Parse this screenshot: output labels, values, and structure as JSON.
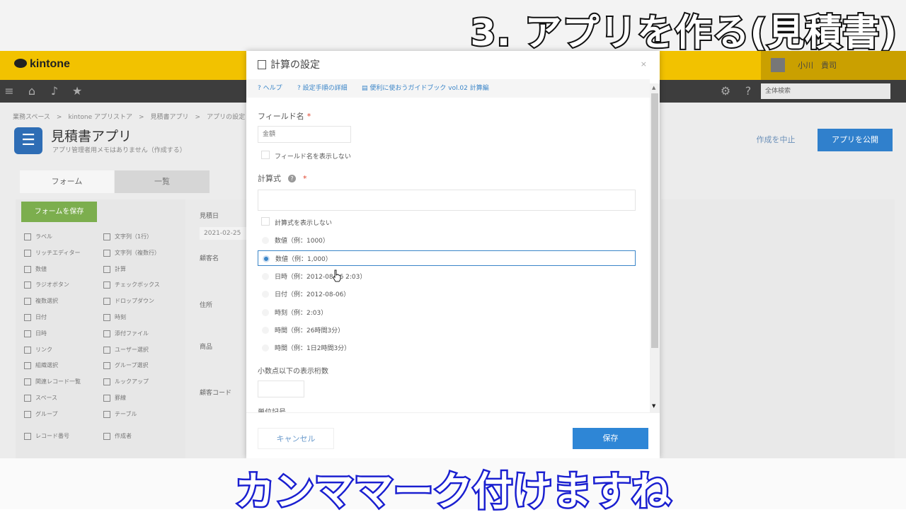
{
  "captions": {
    "top": "3. アプリを作る(見積書)",
    "bottom": "カンママーク付けますね"
  },
  "kintone": {
    "logo": "kintone",
    "user_name": "小川　貴司",
    "search_placeholder": "全体検索",
    "breadcrumb": "業務スペース　>　kintone アプリストア　>　見積書アプリ　>　アプリの設定",
    "app_title": "見積書アプリ",
    "app_memo": "アプリ管理者用メモはありません（作成する）",
    "cancel_edit": "作成を中止",
    "publish": "アプリを公開",
    "tabs": {
      "form": "フォーム",
      "list": "一覧"
    },
    "save_form": "フォームを保存",
    "palette": [
      "ラベル",
      "文字列（1行）",
      "リッチエディター",
      "文字列（複数行）",
      "数値",
      "計算",
      "ラジオボタン",
      "チェックボックス",
      "複数選択",
      "ドロップダウン",
      "日付",
      "時刻",
      "日時",
      "添付ファイル",
      "リンク",
      "ユーザー選択",
      "組織選択",
      "グループ選択",
      "関連レコード一覧",
      "ルックアップ",
      "スペース",
      "罫線",
      "グループ",
      "テーブル",
      "レコード番号",
      "作成者"
    ],
    "canvas": {
      "f1_label": "見積日",
      "f1_value": "2021-02-25",
      "f2_label": "顧客名",
      "f3_label": "住所",
      "f4_label": "商品",
      "f5_label": "顧客コード"
    }
  },
  "dialog": {
    "title": "計算の設定",
    "close": "×",
    "links": {
      "help": "ヘルプ",
      "steps": "設定手順の詳細",
      "guide": "便利に使おうガイドブック vol.02 計算編"
    },
    "field_name_label": "フィールド名",
    "required_mark": "*",
    "field_name_value": "金額",
    "hide_field_name": "フィールド名を表示しない",
    "formula_label": "計算式",
    "formula_value": "",
    "hide_formula": "計算式を表示しない",
    "format_options": [
      {
        "label": "数値（例：1000）",
        "selected": false
      },
      {
        "label": "数値（例：1,000）",
        "selected": true
      },
      {
        "label": "日時（例：2012-08-06 2:03）",
        "selected": false
      },
      {
        "label": "日付（例：2012-08-06）",
        "selected": false
      },
      {
        "label": "時刻（例：2:03）",
        "selected": false
      },
      {
        "label": "時間（例：26時間3分）",
        "selected": false
      },
      {
        "label": "時間（例：1日2時間3分）",
        "selected": false
      }
    ],
    "decimal_label": "小数点以下の表示桁数",
    "decimal_value": "",
    "unit_label": "単位記号",
    "cancel": "キャンセル",
    "save": "保存"
  }
}
